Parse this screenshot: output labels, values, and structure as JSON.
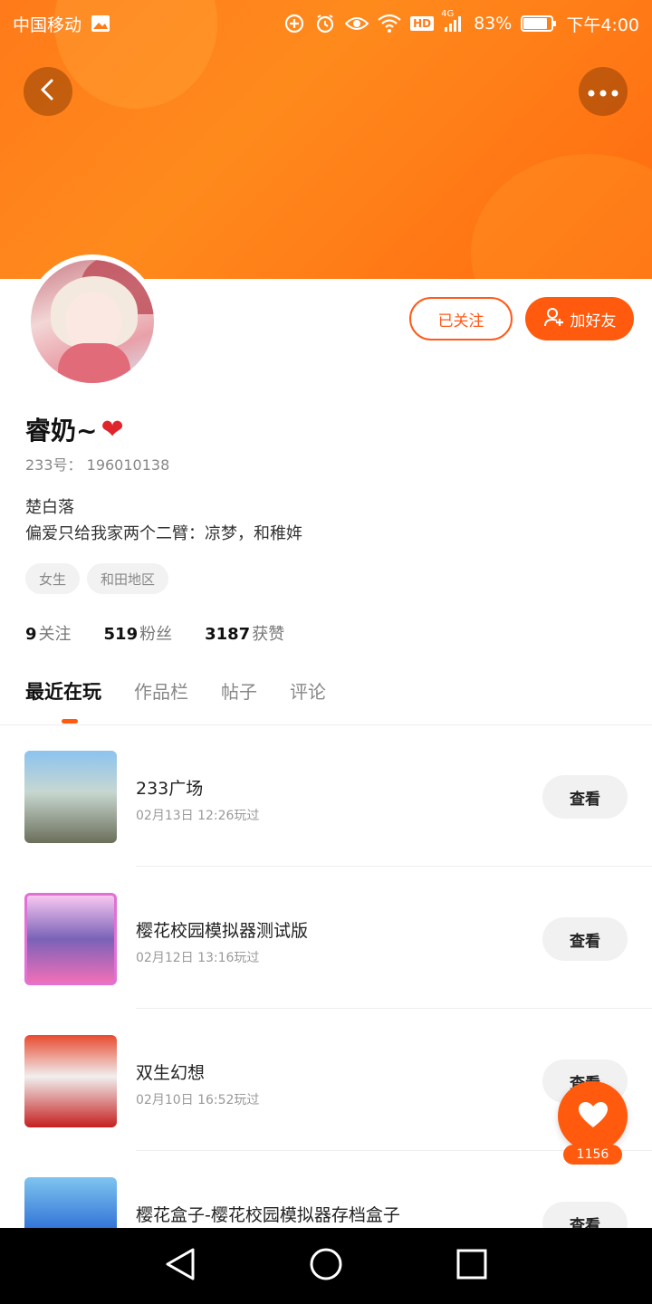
{
  "status_bar": {
    "carrier": "中国移动",
    "network": "4G",
    "hd_label": "HD",
    "battery": "83%",
    "time": "下午4:00",
    "icons": [
      "image-icon",
      "data-saver-icon",
      "alarm-icon",
      "eye-icon",
      "wifi-icon",
      "signal-icon",
      "battery-icon"
    ]
  },
  "header": {
    "back_icon": "chevron-left-icon",
    "more_icon": "more-dots-icon"
  },
  "profile": {
    "username": "睿奶~",
    "username_emoji": "❤",
    "uid_label": "233号：",
    "uid": "196010138",
    "bio_line1": "楚白落",
    "bio_line2": "偏爱只给我家两个二臂：凉梦，和稚姩",
    "tags": [
      "女生",
      "和田地区"
    ],
    "followed_label": "已关注",
    "add_friend_label": "加好友",
    "stats": {
      "following_count": "9",
      "following_label": "关注",
      "fans_count": "519",
      "fans_label": "粉丝",
      "likes_count": "3187",
      "likes_label": "获赞"
    }
  },
  "tabs": [
    "最近在玩",
    "作品栏",
    "帖子",
    "评论"
  ],
  "games": [
    {
      "title": "233广场",
      "time": "02月13日 12:26玩过",
      "button": "查看"
    },
    {
      "title": "樱花校园模拟器测试版",
      "time": "02月12日 13:16玩过",
      "button": "查看"
    },
    {
      "title": "双生幻想",
      "time": "02月10日 16:52玩过",
      "button": "查看"
    },
    {
      "title": "樱花盒子-樱花校园模拟器存档盒子",
      "time": "",
      "button": "查看"
    }
  ],
  "fab": {
    "count": "1156"
  },
  "accent_color": "#ff5a0e"
}
